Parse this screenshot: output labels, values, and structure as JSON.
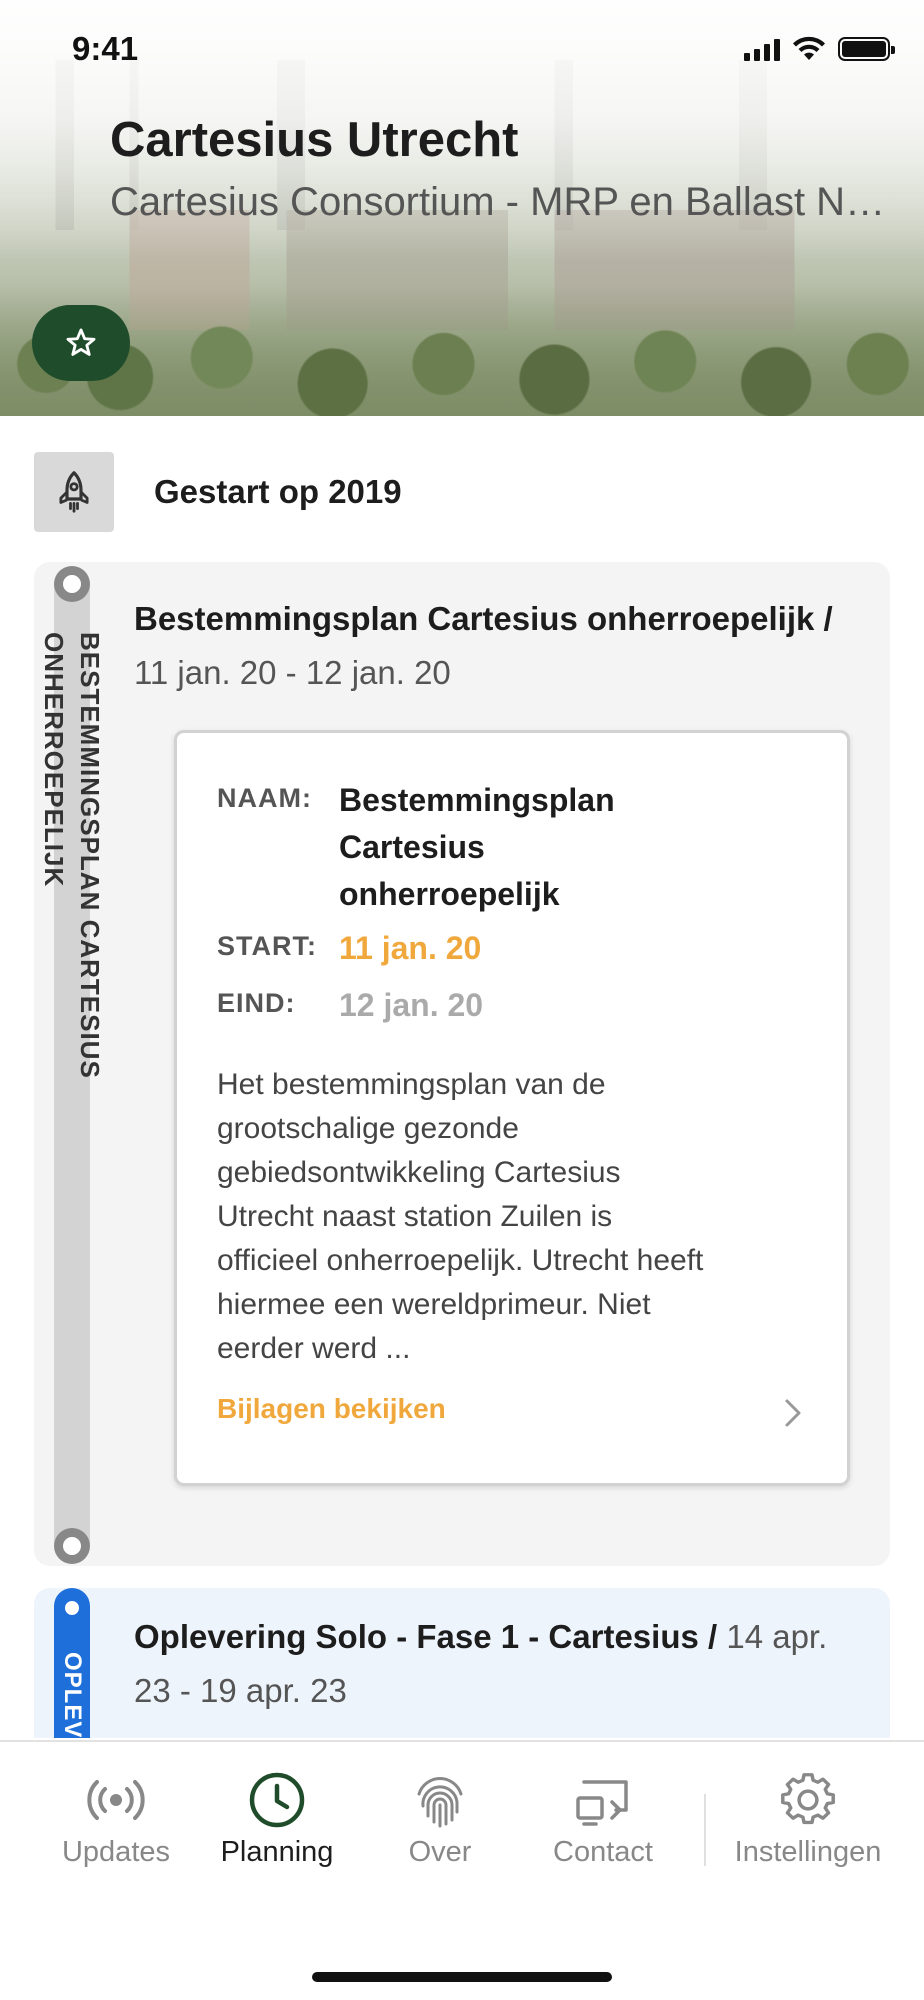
{
  "status_bar": {
    "time": "9:41"
  },
  "header": {
    "title": "Cartesius Utrecht",
    "subtitle": "Cartesius Consortium - MRP en Ballast Nedam"
  },
  "started": {
    "label": "Gestart op 2019"
  },
  "phases": [
    {
      "rail_label": "BESTEMMINGSPLAN CARTESIUS ONHERROEPELIJK",
      "title": "Bestemmingsplan Cartesius onherroepelijk /",
      "dates": "11 jan. 20 - 12 jan. 20",
      "detail": {
        "name_key": "NAAM:",
        "name_value": "Bestemmingsplan Cartesius onherroepelijk",
        "start_key": "START:",
        "start_value": "11 jan. 20",
        "end_key": "EIND:",
        "end_value": "12 jan. 20",
        "description": "Het bestemmingsplan van de grootschalige gezonde gebiedsontwikkeling Cartesius Utrecht naast station Zuilen is officieel onherroepelijk. Utrecht heeft hiermee een wereldprimeur. Niet eerder werd ...",
        "attachments_link": "Bijlagen bekijken"
      }
    },
    {
      "rail_label": "OPLEV",
      "title": "Oplevering Solo - Fase 1 - Cartesius /",
      "dates": "14 apr. 23 - 19 apr. 23"
    }
  ],
  "tabbar": {
    "tabs": [
      {
        "label": "Updates",
        "icon": "broadcast-icon",
        "active": false
      },
      {
        "label": "Planning",
        "icon": "clock-icon",
        "active": true
      },
      {
        "label": "Over",
        "icon": "fingerprint-icon",
        "active": false
      },
      {
        "label": "Contact",
        "icon": "contact-screen-icon",
        "active": false
      },
      {
        "label": "Instellingen",
        "icon": "gear-icon",
        "active": false
      }
    ]
  },
  "colors": {
    "brand_green": "#1f4c2b",
    "accent_orange": "#f0a83c",
    "accent_blue": "#1e6fd9"
  }
}
